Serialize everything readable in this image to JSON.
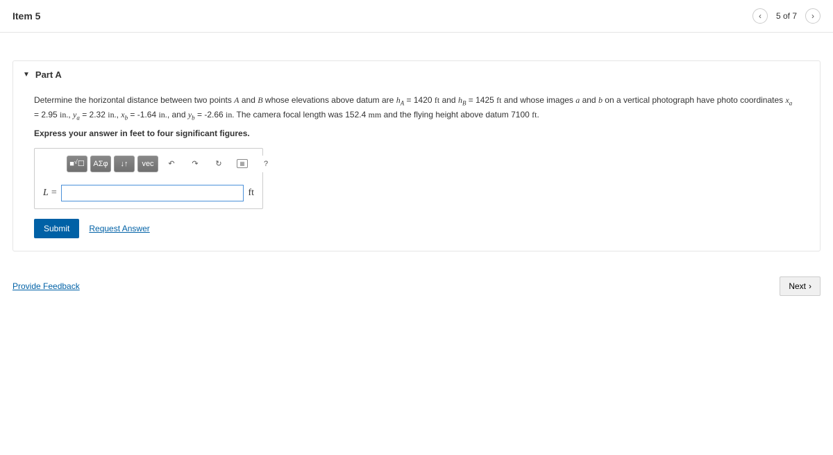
{
  "header": {
    "title": "Item 5",
    "position": "5 of 7"
  },
  "part": {
    "label": "Part A",
    "problem": {
      "pre1": "Determine the horizontal distance between two points ",
      "A": "A",
      "mid1": " and ",
      "B": "B",
      "mid2": " whose elevations above datum are ",
      "hA_sym": "h",
      "hA_sub": "A",
      "eq1": " = 1420 ",
      "ft1": "ft",
      "mid3": " and ",
      "hB_sym": "h",
      "hB_sub": "B",
      "eq2": " = 1425 ",
      "ft2": "ft",
      "mid4": " and whose images ",
      "a": "a",
      "mid5": " and ",
      "b": "b",
      "mid6": " on a vertical photograph have photo coordinates ",
      "xa_sym": "x",
      "xa_sub": "a",
      "eq3": " = 2.95 ",
      "in1": "in.",
      "c1": ", ",
      "ya_sym": "y",
      "ya_sub": "a",
      "eq4": " = 2.32 ",
      "in2": "in.",
      "c2": ", ",
      "xb_sym": "x",
      "xb_sub": "b",
      "eq5": " = -1.64 ",
      "in3": "in.",
      "c3": ", and ",
      "yb_sym": "y",
      "yb_sub": "b",
      "eq6": " = -2.66 ",
      "in4": "in.",
      "end1": " The camera focal length was 152.4 ",
      "mm": "mm",
      "end2": " and the flying height above datum 7100 ",
      "ft3": "ft",
      "end3": "."
    },
    "instruction": "Express your answer in feet to four significant figures.",
    "toolbar": {
      "templates": "√☐",
      "greek": "ΑΣφ",
      "scripts": "↓↑",
      "vec": "vec",
      "undo": "↶",
      "redo": "↷",
      "reset": "↻",
      "keyboard": "⌨",
      "help": "?"
    },
    "answer": {
      "label": "L = ",
      "value": "",
      "unit": "ft"
    },
    "actions": {
      "submit": "Submit",
      "request": "Request Answer"
    }
  },
  "footer": {
    "feedback": "Provide Feedback",
    "next": "Next"
  }
}
